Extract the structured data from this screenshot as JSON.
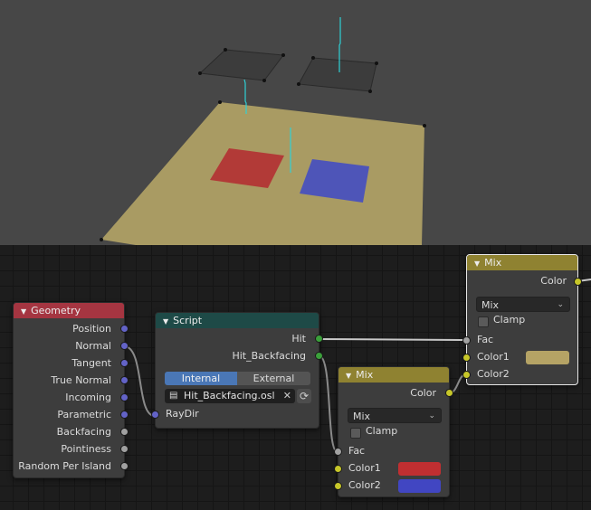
{
  "viewport": {
    "background_color": "#474747",
    "objects": [
      {
        "name": "ground-plane",
        "color": "#a99b63"
      },
      {
        "name": "red-plane",
        "color": "#b23a37"
      },
      {
        "name": "blue-plane",
        "color": "#4e55b8"
      },
      {
        "name": "dark-plane-left",
        "color": "#3c3c3c"
      },
      {
        "name": "dark-plane-right",
        "color": "#3c3c3c"
      }
    ],
    "normal_line_color": "#2fd0d6"
  },
  "nodes": {
    "geometry": {
      "title": "Geometry",
      "header_color": "#a53541",
      "outputs": [
        {
          "label": "Position",
          "type": "vector"
        },
        {
          "label": "Normal",
          "type": "vector"
        },
        {
          "label": "Tangent",
          "type": "vector"
        },
        {
          "label": "True Normal",
          "type": "vector"
        },
        {
          "label": "Incoming",
          "type": "vector"
        },
        {
          "label": "Parametric",
          "type": "vector"
        },
        {
          "label": "Backfacing",
          "type": "float"
        },
        {
          "label": "Pointiness",
          "type": "float"
        },
        {
          "label": "Random Per Island",
          "type": "float"
        }
      ]
    },
    "script": {
      "title": "Script",
      "header_color": "#1e4a47",
      "outputs": [
        {
          "label": "Hit",
          "type": "float"
        },
        {
          "label": "Hit_Backfacing",
          "type": "float"
        }
      ],
      "mode_options": [
        "Internal",
        "External"
      ],
      "mode_selected": "Internal",
      "script_file": "Hit_Backfacing.osl",
      "clear_glyph": "✕",
      "reload_glyph": "⟳",
      "inputs": [
        {
          "label": "RayDir",
          "type": "vector"
        }
      ]
    },
    "mix_inner": {
      "title": "Mix",
      "header_color": "#8f8231",
      "output_label": "Color",
      "blend_mode": "Mix",
      "clamp_label": "Clamp",
      "clamp_checked": false,
      "inputs": [
        {
          "label": "Fac",
          "type": "float"
        },
        {
          "label": "Color1",
          "color": "#c02f31"
        },
        {
          "label": "Color2",
          "color": "#4146c2"
        }
      ]
    },
    "mix_outer": {
      "title": "Mix",
      "header_color": "#8f8231",
      "output_label": "Color",
      "blend_mode": "Mix",
      "clamp_label": "Clamp",
      "clamp_checked": false,
      "selected": true,
      "inputs": [
        {
          "label": "Fac",
          "type": "float"
        },
        {
          "label": "Color1",
          "color": "#b5a365"
        },
        {
          "label": "Color2",
          "type": "color"
        }
      ]
    }
  },
  "links": [
    {
      "from": "geometry.Normal",
      "to": "script.RayDir"
    },
    {
      "from": "script.Hit",
      "to": "mix_outer.Fac"
    },
    {
      "from": "script.Hit_Backfacing",
      "to": "mix_inner.Fac"
    },
    {
      "from": "mix_inner.Color",
      "to": "mix_outer.Color2"
    },
    {
      "from": "mix_outer.Color",
      "to": "offscreen"
    }
  ]
}
